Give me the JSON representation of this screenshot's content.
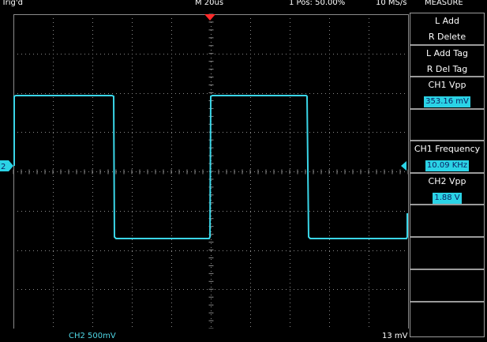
{
  "status_bar": {
    "trigger_state": "Trig'd",
    "timebase": "M 20us",
    "trigger_position": "1 Pos: 50.00%",
    "sample_rate": "10 MS/s",
    "menu_title": "MEASURE"
  },
  "screen": {
    "channel_marker": "2",
    "colors": {
      "grid": "#8a8a8a",
      "trace": "#3ad6e8",
      "trigger_marker": "#ff2a2a",
      "value_box_bg": "#2bd3e6",
      "value_box_text": "#0b1e60"
    },
    "icons": [
      "trigger-position-icon",
      "channel-ground-marker-icon",
      "trigger-level-arrow-icon"
    ]
  },
  "bottom_bar": {
    "channel_scale": "CH2  500mV",
    "trigger_level": "13 mV"
  },
  "measure_menu": {
    "add_label": "L Add",
    "delete_label": "R Delete",
    "add_tag_label": "L Add Tag",
    "del_tag_label": "R Del Tag",
    "measurements": [
      {
        "name": "CH1 Vpp",
        "value": "353.16 mV"
      },
      {
        "name": "CH1 Frequency",
        "value": "10.09 KHz"
      },
      {
        "name": "CH2 Vpp",
        "value": "1.88 V"
      }
    ]
  }
}
